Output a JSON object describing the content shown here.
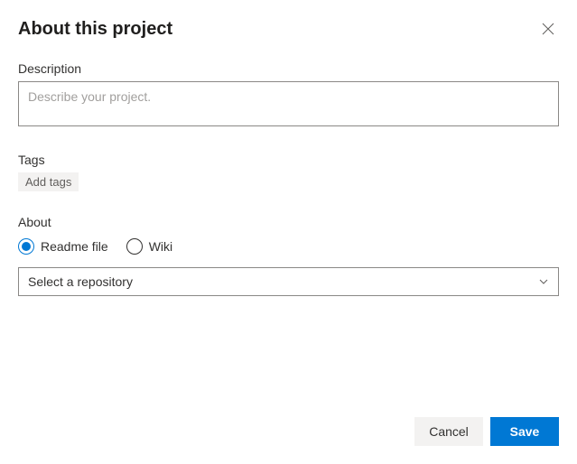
{
  "header": {
    "title": "About this project"
  },
  "description": {
    "label": "Description",
    "placeholder": "Describe your project.",
    "value": ""
  },
  "tags": {
    "label": "Tags",
    "add_label": "Add tags"
  },
  "about": {
    "label": "About",
    "options": {
      "readme": "Readme file",
      "wiki": "Wiki"
    },
    "selected": "readme",
    "dropdown_placeholder": "Select a repository"
  },
  "footer": {
    "cancel": "Cancel",
    "save": "Save"
  }
}
